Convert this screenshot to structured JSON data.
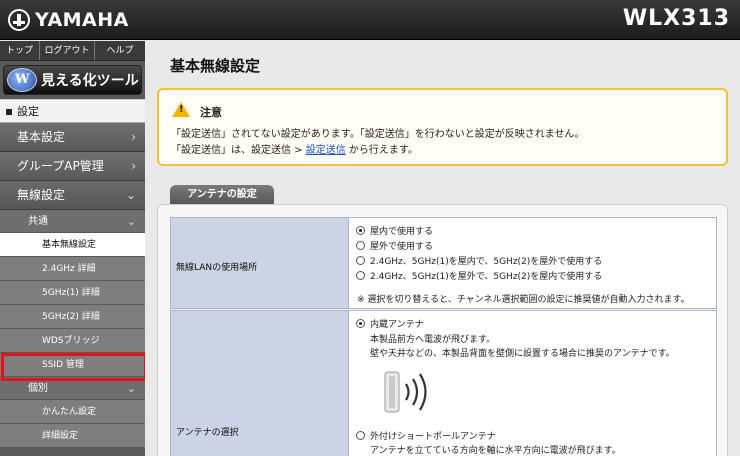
{
  "header": {
    "brand": "YAMAHA",
    "model": "WLX313"
  },
  "sidebar": {
    "top_links": [
      "トップ",
      "ログアウト",
      "ヘルプ"
    ],
    "viz_tool": "見える化ツール",
    "section": "設定",
    "nav": {
      "basic": "基本設定",
      "group_ap": "グループAP管理",
      "wireless": "無線設定",
      "common": "共通",
      "common_items": [
        "基本無線設定",
        "2.4GHz 詳細",
        "5GHz(1) 詳細",
        "5GHz(2) 詳細",
        "WDSブリッジ",
        "SSID 管理"
      ],
      "individual": "個別",
      "individual_items": [
        "かんたん設定",
        "詳細設定"
      ]
    }
  },
  "main": {
    "title": "基本無線設定",
    "notice": {
      "title": "注意",
      "line1": "「設定送信」されてない設定があります。「設定送信」を行わないと設定が反映されません。",
      "line2_pre": "「設定送信」は、設定送信 > ",
      "line2_link": "設定送信",
      "line2_post": " から行えます。"
    },
    "panel_tab": "アンテナの設定",
    "usage": {
      "label": "無線LANの使用場所",
      "options": [
        "屋内で使用する",
        "屋外で使用する",
        "2.4GHz、5GHz(1)を屋内で、5GHz(2)を屋外で使用する",
        "2.4GHz、5GHz(1)を屋外で、5GHz(2)を屋内で使用する"
      ],
      "hint": "※ 選択を切り替えると、チャンネル選択範囲の設定に推奨値が自動入力されます。"
    },
    "antenna": {
      "label": "アンテナの選択",
      "internal": "内蔵アンテナ",
      "internal_desc1": "本製品前方へ電波が飛びます。",
      "internal_desc2": "壁や天井などの、本製品背面を壁側に設置する場合に推奨のアンテナです。",
      "external": "外付けショートポールアンテナ",
      "external_desc": "アンテナを立てている方向を軸に水平方向に電波が飛びます。"
    }
  }
}
